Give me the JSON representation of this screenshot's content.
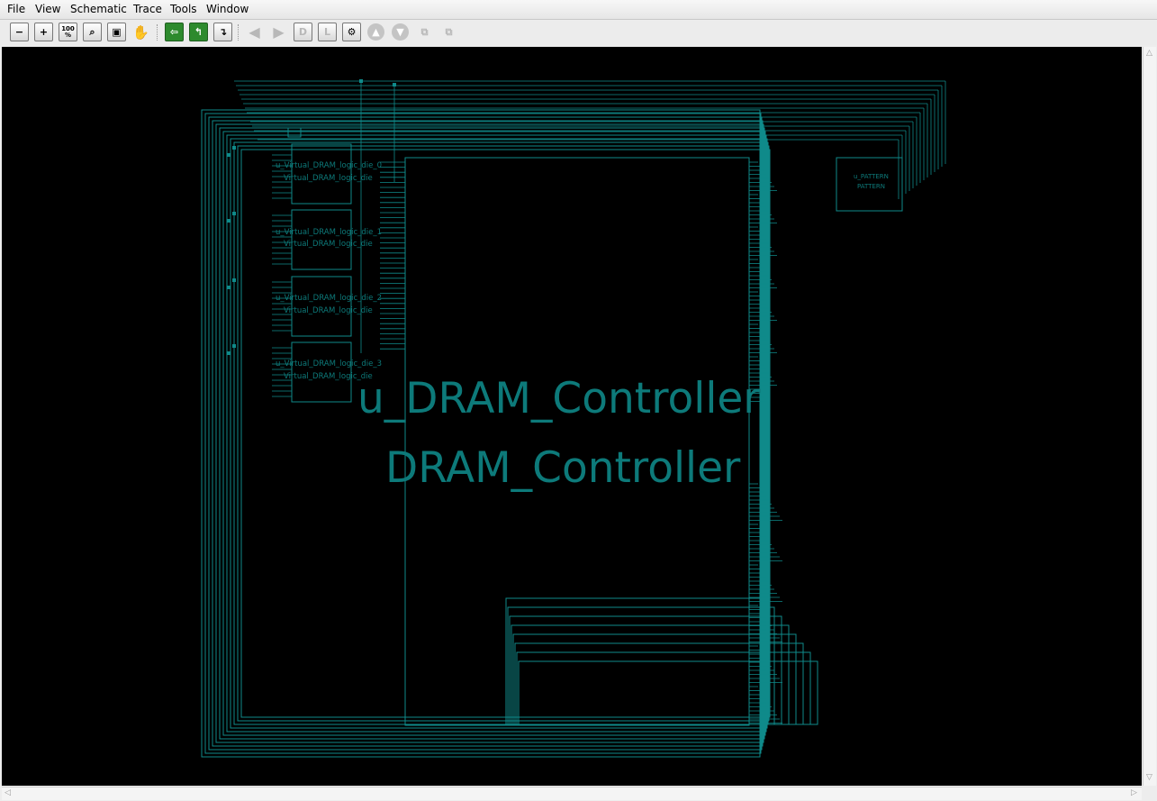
{
  "menu": [
    "File",
    "View",
    "Schematic",
    "Trace",
    "Tools",
    "Window"
  ],
  "toolbar": {
    "zoom_100_label": "100\n%"
  },
  "schematic": {
    "controller": {
      "instance": "u_DRAM_Controller",
      "module": "DRAM_Controller"
    },
    "logic_dies": [
      {
        "instance": "u_Virtual_DRAM_logic_die_0",
        "module": "Virtual_DRAM_logic_die"
      },
      {
        "instance": "u_Virtual_DRAM_logic_die_1",
        "module": "Virtual_DRAM_logic_die"
      },
      {
        "instance": "u_Virtual_DRAM_logic_die_2",
        "module": "Virtual_DRAM_logic_die"
      },
      {
        "instance": "u_Virtual_DRAM_logic_die_3",
        "module": "Virtual_DRAM_logic_die"
      }
    ],
    "pattern": {
      "instance": "u_PATTERN",
      "module": "PATTERN"
    },
    "colors": {
      "wire": "#0f8a8a",
      "text": "#0d7a7a",
      "background": "#000000"
    }
  }
}
